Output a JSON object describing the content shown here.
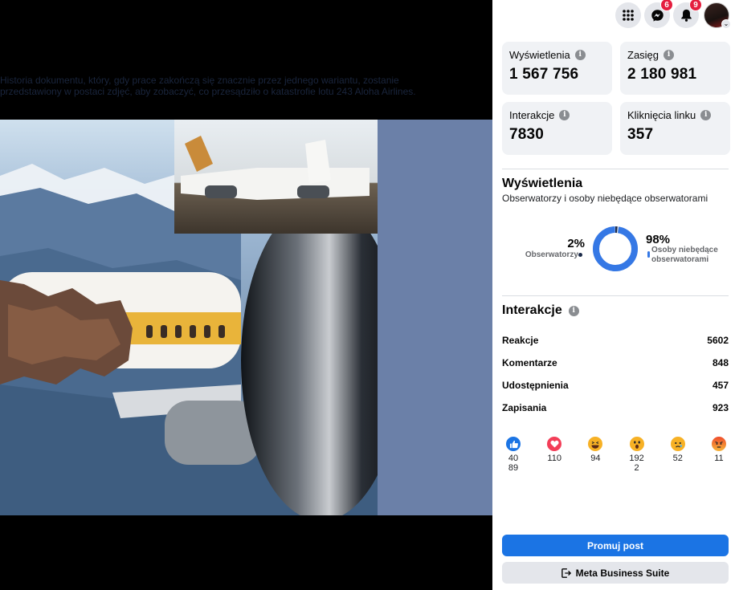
{
  "media": {
    "caption": "Historia dokumentu, który, gdy prace zakończą się znacznie przez jednego wariantu, zostanie przedstawiony w postaci zdjęć, aby zobaczyć, co przesądziło o katastrofie lotu 243 Aloha Airlines."
  },
  "topbar": {
    "apps_icon": "grid-icon",
    "messenger_badge": "6",
    "notifications_badge": "9"
  },
  "stats": [
    {
      "label": "Wyświetlenia",
      "value": "1 567 756"
    },
    {
      "label": "Zasięg",
      "value": "2 180 981"
    },
    {
      "label": "Interakcje",
      "value": "7830"
    },
    {
      "label": "Kliknięcia linku",
      "value": "357"
    }
  ],
  "views": {
    "title": "Wyświetlenia",
    "subtitle": "Obserwatorzy i osoby niebędące obserwatorami",
    "followers_pct": "2%",
    "followers_label": "Obserwatorzy",
    "followers_fraction": 0.02,
    "nonfollowers_pct": "98%",
    "nonfollowers_label": "Osoby niebędące obserwatorami"
  },
  "interactions": {
    "title": "Interakcje",
    "rows": [
      {
        "label": "Reakcje",
        "value": "5602"
      },
      {
        "label": "Komentarze",
        "value": "848"
      },
      {
        "label": "Udostępnienia",
        "value": "457"
      },
      {
        "label": "Zapisania",
        "value": "923"
      }
    ]
  },
  "reactions": [
    {
      "icon": "like-icon",
      "value": "40\n89"
    },
    {
      "icon": "love-icon",
      "value": "110"
    },
    {
      "icon": "haha-icon",
      "value": "94"
    },
    {
      "icon": "wow-icon",
      "value": "192\n2"
    },
    {
      "icon": "sad-icon",
      "value": "52"
    },
    {
      "icon": "angry-icon",
      "value": "11"
    }
  ],
  "buttons": {
    "promote": "Promuj post",
    "business_suite": "Meta Business Suite"
  },
  "colors": {
    "accent": "#1b74e4",
    "donut_main": "#3578e5",
    "donut_minor": "#1c2b4a",
    "badge": "#e41e3f"
  }
}
